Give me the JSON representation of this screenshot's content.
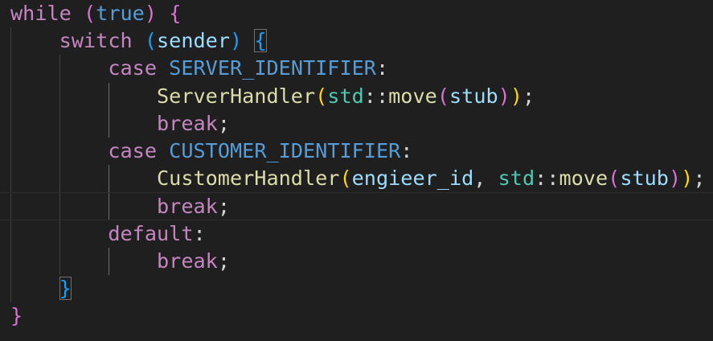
{
  "colors": {
    "background": "#1f1f1f",
    "keyword_control": "#c586c0",
    "keyword": "#569cd6",
    "function": "#dcdcaa",
    "type": "#4ec9b0",
    "variable": "#9cdcfe",
    "constant": "#4fc1ff",
    "punctuation": "#d4d4d4",
    "bracket_gold": "#ffd700",
    "bracket_purple": "#da70d6",
    "bracket_blue": "#179fff"
  },
  "code": {
    "lines": [
      {
        "indent": "",
        "tokens": [
          {
            "text": "while",
            "color": "#c586c0"
          },
          {
            "text": " ",
            "color": "#d4d4d4"
          },
          {
            "text": "(",
            "color": "#da70d6"
          },
          {
            "text": "true",
            "color": "#569cd6"
          },
          {
            "text": ")",
            "color": "#da70d6"
          },
          {
            "text": " ",
            "color": "#d4d4d4"
          },
          {
            "text": "{",
            "color": "#da70d6"
          }
        ]
      },
      {
        "indent": "    ",
        "tokens": [
          {
            "text": "switch",
            "color": "#c586c0"
          },
          {
            "text": " ",
            "color": "#d4d4d4"
          },
          {
            "text": "(",
            "color": "#179fff"
          },
          {
            "text": "sender",
            "color": "#9cdcfe"
          },
          {
            "text": ")",
            "color": "#179fff"
          },
          {
            "text": " ",
            "color": "#d4d4d4"
          },
          {
            "text": "{",
            "color": "#179fff",
            "match": true
          }
        ]
      },
      {
        "indent": "        ",
        "tokens": [
          {
            "text": "case",
            "color": "#c586c0"
          },
          {
            "text": " ",
            "color": "#d4d4d4"
          },
          {
            "text": "SERVER_IDENTIFIER",
            "color": "#569cd6"
          },
          {
            "text": ":",
            "color": "#d4d4d4"
          }
        ]
      },
      {
        "indent": "            ",
        "tokens": [
          {
            "text": "ServerHandler",
            "color": "#dcdcaa"
          },
          {
            "text": "(",
            "color": "#ffd700"
          },
          {
            "text": "std",
            "color": "#4ec9b0"
          },
          {
            "text": "::",
            "color": "#d4d4d4"
          },
          {
            "text": "move",
            "color": "#dcdcaa"
          },
          {
            "text": "(",
            "color": "#da70d6"
          },
          {
            "text": "stub",
            "color": "#9cdcfe"
          },
          {
            "text": ")",
            "color": "#da70d6"
          },
          {
            "text": ")",
            "color": "#ffd700"
          },
          {
            "text": ";",
            "color": "#d4d4d4"
          }
        ]
      },
      {
        "indent": "            ",
        "tokens": [
          {
            "text": "break",
            "color": "#c586c0"
          },
          {
            "text": ";",
            "color": "#d4d4d4"
          }
        ]
      },
      {
        "indent": "        ",
        "tokens": [
          {
            "text": "case",
            "color": "#c586c0"
          },
          {
            "text": " ",
            "color": "#d4d4d4"
          },
          {
            "text": "CUSTOMER_IDENTIFIER",
            "color": "#569cd6"
          },
          {
            "text": ":",
            "color": "#d4d4d4"
          }
        ]
      },
      {
        "indent": "            ",
        "tokens": [
          {
            "text": "CustomerHandler",
            "color": "#dcdcaa"
          },
          {
            "text": "(",
            "color": "#ffd700"
          },
          {
            "text": "engieer_id",
            "color": "#9cdcfe"
          },
          {
            "text": ", ",
            "color": "#d4d4d4"
          },
          {
            "text": "std",
            "color": "#4ec9b0"
          },
          {
            "text": "::",
            "color": "#d4d4d4"
          },
          {
            "text": "move",
            "color": "#dcdcaa"
          },
          {
            "text": "(",
            "color": "#da70d6"
          },
          {
            "text": "stub",
            "color": "#9cdcfe"
          },
          {
            "text": ")",
            "color": "#da70d6"
          },
          {
            "text": ")",
            "color": "#ffd700"
          },
          {
            "text": ";",
            "color": "#d4d4d4"
          }
        ]
      },
      {
        "indent": "            ",
        "current": true,
        "tokens": [
          {
            "text": "break",
            "color": "#c586c0"
          },
          {
            "text": ";",
            "color": "#d4d4d4"
          }
        ]
      },
      {
        "indent": "        ",
        "tokens": [
          {
            "text": "default",
            "color": "#c586c0"
          },
          {
            "text": ":",
            "color": "#d4d4d4"
          }
        ]
      },
      {
        "indent": "            ",
        "tokens": [
          {
            "text": "break",
            "color": "#c586c0"
          },
          {
            "text": ";",
            "color": "#d4d4d4"
          }
        ]
      },
      {
        "indent": "    ",
        "tokens": [
          {
            "text": "}",
            "color": "#179fff",
            "match": true
          }
        ]
      },
      {
        "indent": "",
        "tokens": [
          {
            "text": "}",
            "color": "#da70d6"
          }
        ]
      }
    ]
  }
}
